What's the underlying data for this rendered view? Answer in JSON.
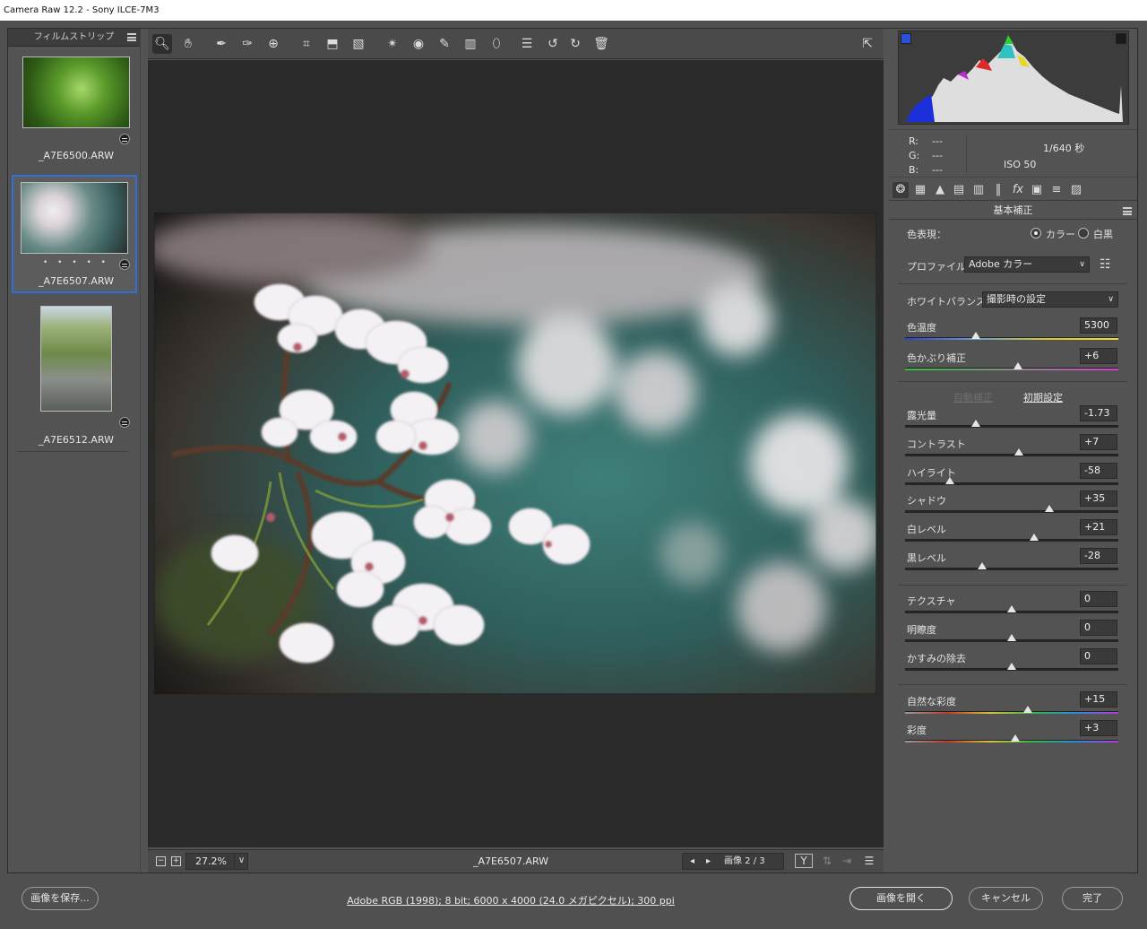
{
  "window": {
    "title": "Camera Raw 12.2  -  Sony ILCE-7M3"
  },
  "filmstrip": {
    "title": "フィルムストリップ",
    "items": [
      {
        "name": "_A7E6500.ARW",
        "selected": false
      },
      {
        "name": "_A7E6507.ARW",
        "selected": true,
        "rating": "• • • • •"
      },
      {
        "name": "_A7E6512.ARW",
        "selected": false
      }
    ]
  },
  "toolbar": {
    "tools": [
      "zoom-tool",
      "hand-tool",
      "white-balance-tool",
      "color-sampler-tool",
      "targeted-adjustment-tool",
      "crop-tool",
      "straighten-tool",
      "transform-tool",
      "spot-removal-tool",
      "red-eye-tool",
      "adjustment-brush",
      "graduated-filter",
      "radial-filter",
      "preferences",
      "rotate-left",
      "rotate-right",
      "delete"
    ]
  },
  "preview": {
    "zoom": "27.2%",
    "filename": "_A7E6507.ARW",
    "image_counter": "画像 2 / 3"
  },
  "histogram": {
    "r_label": "R:",
    "r_value": "---",
    "g_label": "G:",
    "g_value": "---",
    "b_label": "B:",
    "b_value": "---",
    "shutter": "1/640 秒",
    "iso": "ISO 50"
  },
  "panel": {
    "title": "基本補正",
    "treatment_label": "色表現：",
    "treatment_color": "カラー",
    "treatment_bw": "白黒",
    "profile_label": "プロファイル：",
    "profile_value": "Adobe カラー",
    "wb_label": "ホワイトバランス：",
    "wb_value": "撮影時の設定",
    "auto": "自動補正",
    "default": "初期設定",
    "sliders": [
      {
        "label": "色温度",
        "value": "5300",
        "pos": 0.33
      },
      {
        "label": "色かぶり補正",
        "value": "+6",
        "pos": 0.53
      },
      {
        "label": "露光量",
        "value": "-1.73",
        "pos": 0.33
      },
      {
        "label": "コントラスト",
        "value": "+7",
        "pos": 0.535
      },
      {
        "label": "ハイライト",
        "value": "-58",
        "pos": 0.21
      },
      {
        "label": "シャドウ",
        "value": "+35",
        "pos": 0.675
      },
      {
        "label": "白レベル",
        "value": "+21",
        "pos": 0.605
      },
      {
        "label": "黒レベル",
        "value": "-28",
        "pos": 0.36
      },
      {
        "label": "テクスチャ",
        "value": "0",
        "pos": 0.5
      },
      {
        "label": "明瞭度",
        "value": "0",
        "pos": 0.5
      },
      {
        "label": "かすみの除去",
        "value": "0",
        "pos": 0.5
      },
      {
        "label": "自然な彩度",
        "value": "+15",
        "pos": 0.575
      },
      {
        "label": "彩度",
        "value": "+3",
        "pos": 0.515
      }
    ]
  },
  "footer": {
    "save": "画像を保存...",
    "workflow": "Adobe RGB (1998); 8 bit; 6000 x 4000 (24.0 メガピクセル); 300 ppi",
    "open": "画像を開く",
    "cancel": "キャンセル",
    "done": "完了"
  },
  "colors": {
    "accent": "#2f6fd6",
    "panel": "#535353",
    "canvas": "#2a2a2a"
  }
}
